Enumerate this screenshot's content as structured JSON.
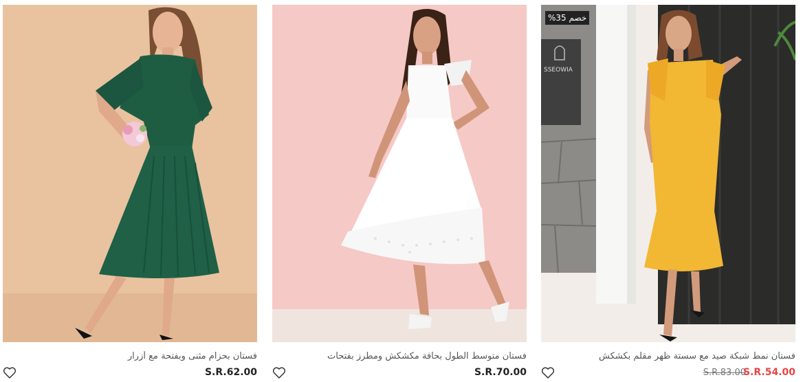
{
  "colors": {
    "sale": "#e64545",
    "price": "#222222",
    "title": "#555555",
    "badge_bg": "#222222"
  },
  "products": [
    {
      "title": "فستان بحزام مثنى وبفتحة مع أزرار",
      "price": "S.R.62.00",
      "wishlist_icon": "heart-outline-icon",
      "image": "model-green-pleated-dress"
    },
    {
      "title": "فستان متوسط الطول بحافة مكشكش ومطرز بفتحات",
      "price": "S.R.70.00",
      "wishlist_icon": "heart-outline-icon",
      "image": "model-white-eyelet-dress"
    },
    {
      "title": "فستان نمط شبكة صيد مع سستة ظهر مقلم بكشكش",
      "price": "S.R.54.00",
      "old_price": "S.R.83.00",
      "badge": "خصم 35%",
      "sign_text": "SSEOWIA",
      "wishlist_icon": "heart-outline-icon",
      "image": "model-yellow-mermaid-dress"
    }
  ]
}
